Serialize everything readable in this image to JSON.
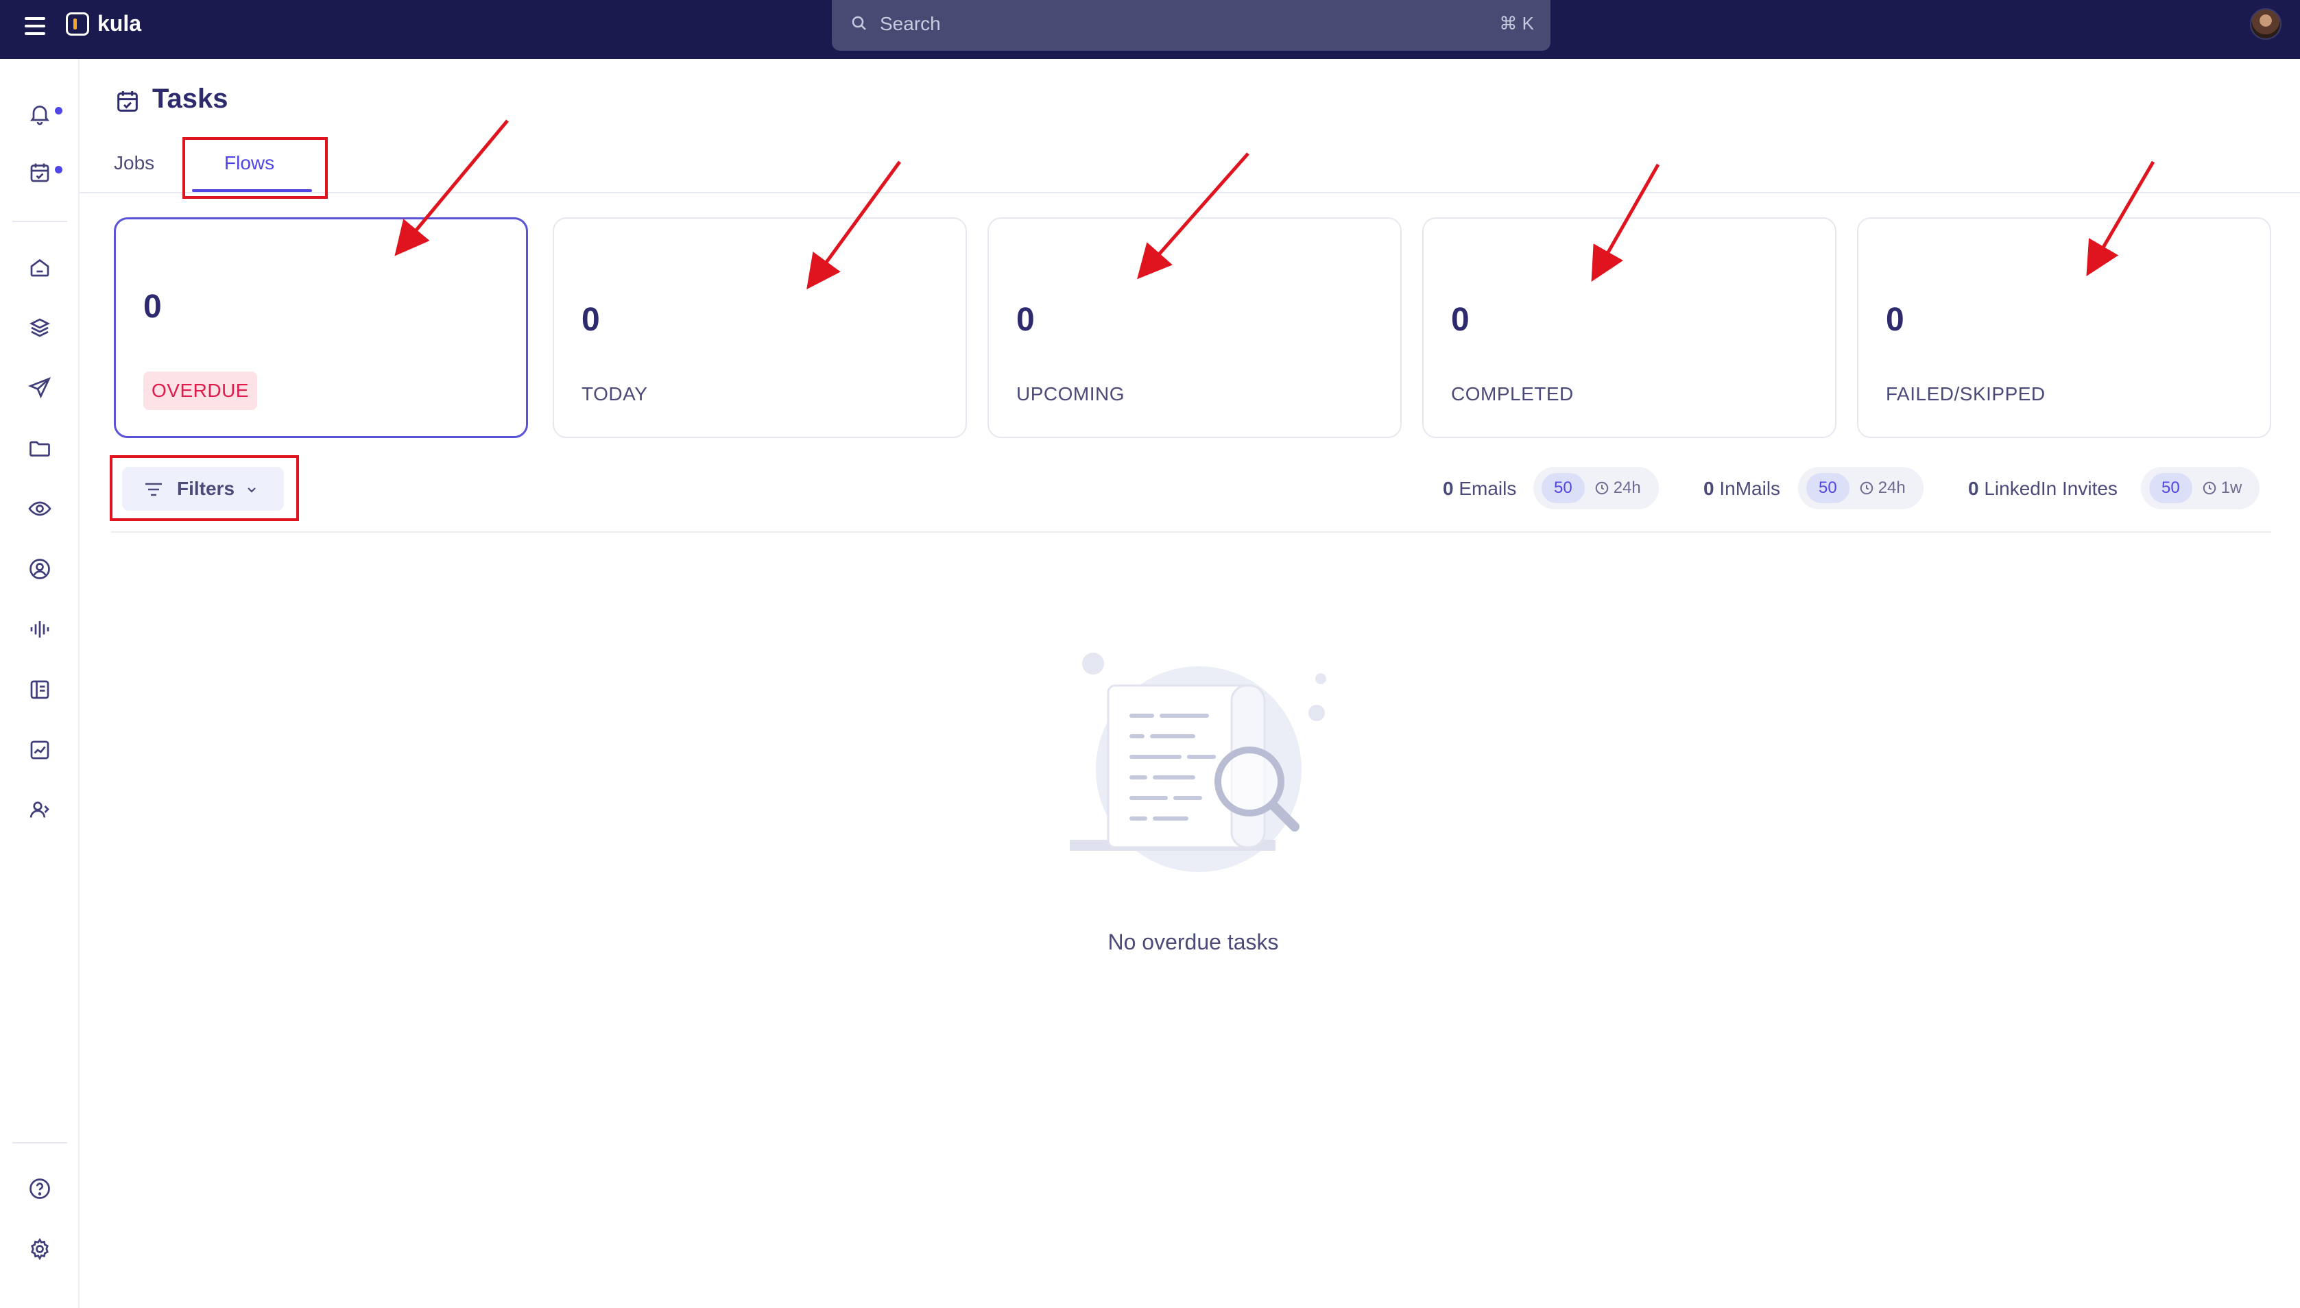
{
  "app": {
    "name": "kula",
    "search": {
      "placeholder": "Search",
      "shortcut": "⌘ K"
    }
  },
  "sidebar": {
    "items": [
      {
        "name": "bell-icon",
        "has_dot": true
      },
      {
        "name": "calendar-check-icon",
        "has_dot": true
      },
      {
        "name": "home-icon"
      },
      {
        "name": "layers-icon"
      },
      {
        "name": "send-icon"
      },
      {
        "name": "folder-icon"
      },
      {
        "name": "eye-icon"
      },
      {
        "name": "user-circle-icon"
      },
      {
        "name": "audio-wave-icon"
      },
      {
        "name": "book-icon"
      },
      {
        "name": "chart-icon"
      },
      {
        "name": "users-icon"
      }
    ],
    "bottom": [
      {
        "name": "help-icon"
      },
      {
        "name": "settings-gear-icon"
      }
    ]
  },
  "page": {
    "title": "Tasks",
    "tabs": [
      {
        "label": "Jobs",
        "active": false
      },
      {
        "label": "Flows",
        "active": true
      }
    ]
  },
  "stats": [
    {
      "value": "0",
      "label": "OVERDUE",
      "active": true
    },
    {
      "value": "0",
      "label": "TODAY"
    },
    {
      "value": "0",
      "label": "UPCOMING"
    },
    {
      "value": "0",
      "label": "COMPLETED"
    },
    {
      "value": "0",
      "label": "FAILED/SKIPPED"
    }
  ],
  "filters": {
    "label": "Filters"
  },
  "quotas": [
    {
      "count": "0",
      "label": "Emails",
      "limit": "50",
      "period": "24h"
    },
    {
      "count": "0",
      "label": "InMails",
      "limit": "50",
      "period": "24h"
    },
    {
      "count": "0",
      "label": "LinkedIn Invites",
      "limit": "50",
      "period": "1w"
    }
  ],
  "empty_state": {
    "message": "No overdue tasks"
  },
  "colors": {
    "topbar": "#1a1a4e",
    "accent": "#4f46e5",
    "overdue_badge_bg": "#fde2e6",
    "overdue_badge_text": "#e01b4c",
    "annotation_red": "#e0141e"
  }
}
